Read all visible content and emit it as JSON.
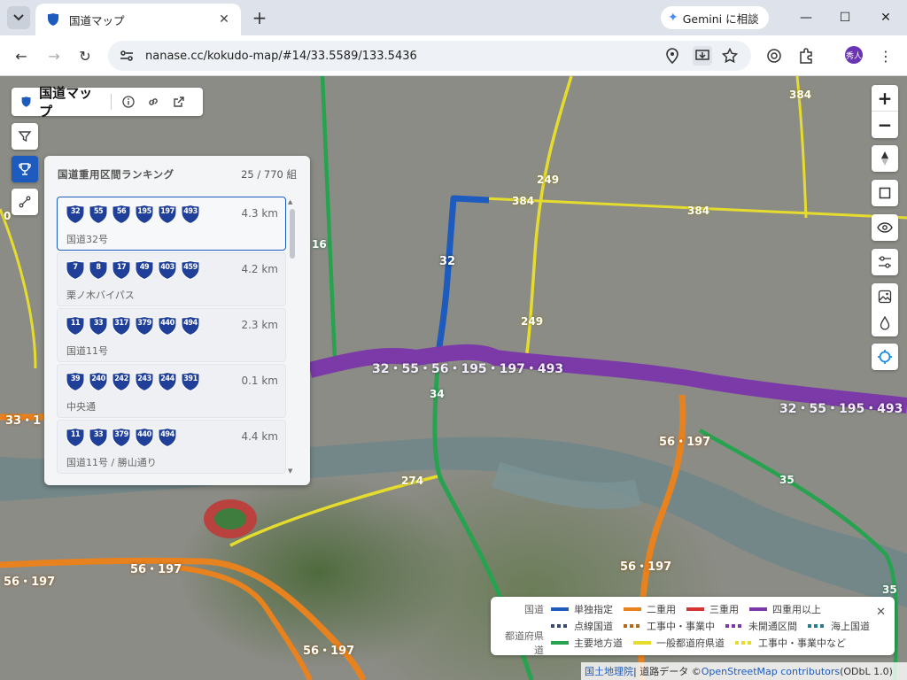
{
  "browser": {
    "tab_title": "国道マップ",
    "gemini_label": "Gemini に相談",
    "url": "nanase.cc/kokudo-map/#14/33.5589/133.5436",
    "avatar_text": "秀人"
  },
  "app": {
    "title": "国道マップ"
  },
  "ranking": {
    "title": "国道重用区間ランキング",
    "count": "25 / 770 組",
    "items": [
      {
        "routes": [
          "32",
          "55",
          "56",
          "195",
          "197",
          "493"
        ],
        "distance": "4.3 km",
        "name": "国道32号",
        "selected": true
      },
      {
        "routes": [
          "7",
          "8",
          "17",
          "49",
          "403",
          "459"
        ],
        "distance": "4.2 km",
        "name": "栗ノ木バイパス",
        "selected": false
      },
      {
        "routes": [
          "11",
          "33",
          "317",
          "379",
          "440",
          "494"
        ],
        "distance": "2.3 km",
        "name": "国道11号",
        "selected": false
      },
      {
        "routes": [
          "39",
          "240",
          "242",
          "243",
          "244",
          "391"
        ],
        "distance": "0.1 km",
        "name": "中央通",
        "selected": false
      },
      {
        "routes": [
          "11",
          "33",
          "379",
          "440",
          "494"
        ],
        "distance": "4.4 km",
        "name": "国道11号 / 勝山通り",
        "selected": false
      }
    ]
  },
  "map_labels": {
    "multi_main": "32・55・56・195・197・493",
    "multi_east": "32・55・195・493",
    "r32": "32",
    "r34": "34",
    "r16": "16",
    "r249a": "249",
    "r249b": "249",
    "r384a": "384",
    "r384b": "384",
    "r384c": "384",
    "r274": "274",
    "r35a": "35",
    "r35b": "35",
    "r56_197_a": "56・197",
    "r56_197_b": "56・197",
    "r56_197_c": "56・197",
    "r56_197_d": "56・197",
    "r56_197_e": "56・197",
    "r33_left": "33・1",
    "r0_left": "0"
  },
  "legend": {
    "national_label": "国道",
    "prefectural_label": "都道府県道",
    "row1": [
      {
        "label": "単独指定",
        "color": "#1d5bbf",
        "dashed": false
      },
      {
        "label": "二重用",
        "color": "#e8821e",
        "dashed": false
      },
      {
        "label": "三重用",
        "color": "#d43434",
        "dashed": false
      },
      {
        "label": "四重用以上",
        "color": "#7b3aa8",
        "dashed": false
      }
    ],
    "row2": [
      {
        "label": "点線国道",
        "color": "#3a4a6e",
        "dashed": true
      },
      {
        "label": "工事中・事業中",
        "color": "#b06a1e",
        "dashed": true
      },
      {
        "label": "未開通区間",
        "color": "#7b3aa8",
        "dashed": true
      },
      {
        "label": "海上国道",
        "color": "#2a7a8a",
        "dashed": true
      }
    ],
    "row3": [
      {
        "label": "主要地方道",
        "color": "#27a350",
        "dashed": false
      },
      {
        "label": "一般都道府県道",
        "color": "#e6dc2e",
        "dashed": false
      },
      {
        "label": "工事中・事業中など",
        "color": "#e6dc2e",
        "dashed": true
      }
    ]
  },
  "attribution": {
    "gsi": "国土地理院",
    "sep": " | 道路データ © ",
    "osm": "OpenStreetMap contributors",
    "license": " (ODbL 1.0)"
  },
  "colors": {
    "single": "#1d5bbf",
    "double": "#e8821e",
    "quad": "#7b3aa8",
    "major_pref": "#27a350",
    "pref": "#e6dc2e"
  }
}
